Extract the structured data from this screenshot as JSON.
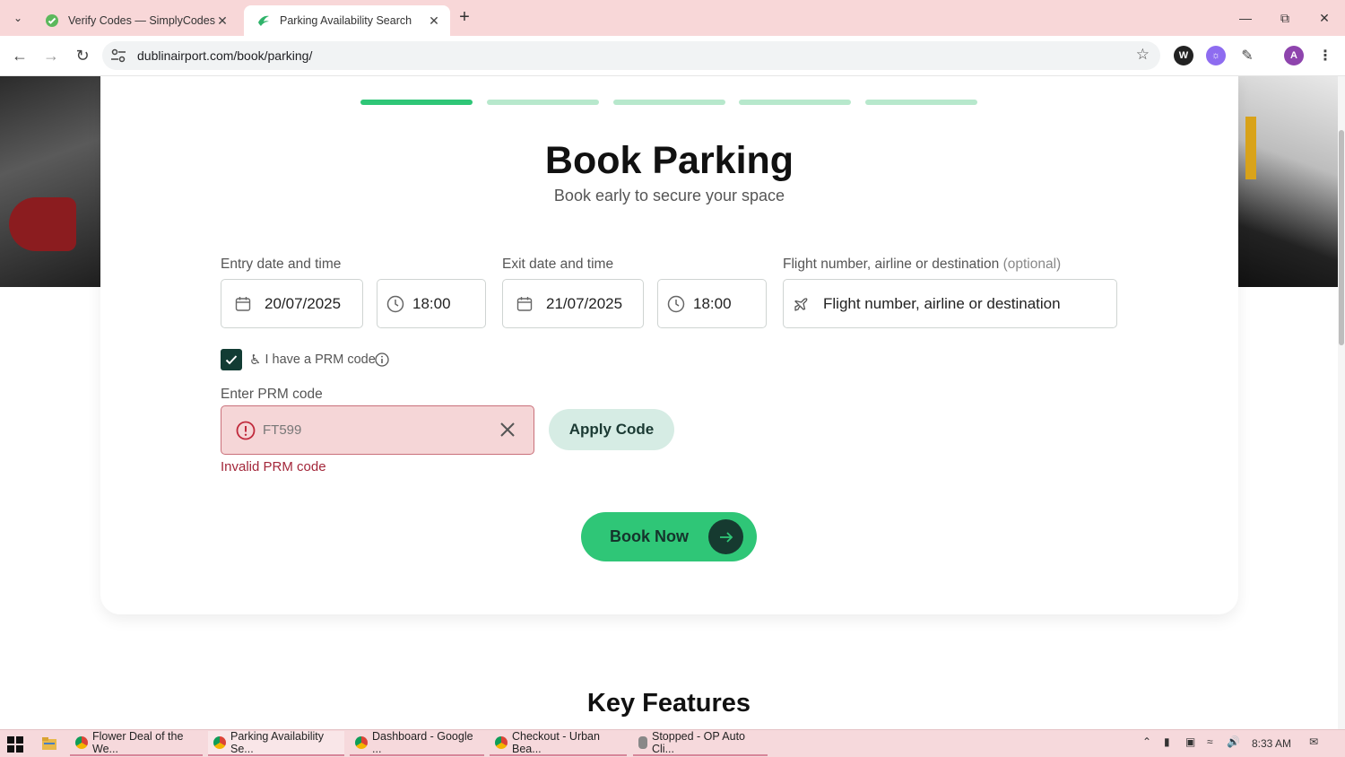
{
  "browser": {
    "tabs": [
      {
        "title": "Verify Codes — SimplyCodes",
        "active": false
      },
      {
        "title": "Parking Availability Search",
        "active": true
      }
    ],
    "url": "dublinairport.com/book/parking/",
    "profile_initial": "A"
  },
  "progress": {
    "total_steps": 5,
    "current_step": 1,
    "colors": {
      "active": "#2fc677",
      "inactive": "#b7e8cc"
    }
  },
  "page": {
    "title": "Book Parking",
    "subtitle": "Book early to secure your space",
    "entry": {
      "label": "Entry date and time",
      "date": "20/07/2025",
      "time": "18:00"
    },
    "exit": {
      "label": "Exit date and time",
      "date": "21/07/2025",
      "time": "18:00"
    },
    "flight": {
      "label": "Flight number, airline or destination",
      "optional": "(optional)",
      "placeholder": "Flight number, airline or destination"
    },
    "prm_checkbox": {
      "label": "I have a PRM code",
      "checked": true
    },
    "prm": {
      "label": "Enter PRM code",
      "value": "FT599",
      "error": "Invalid PRM code",
      "apply_label": "Apply Code"
    },
    "book_label": "Book Now",
    "next_section": "Key Features"
  },
  "taskbar": {
    "apps": [
      {
        "label": "Flower Deal of the We..."
      },
      {
        "label": "Parking Availability Se..."
      },
      {
        "label": "Dashboard - Google ..."
      },
      {
        "label": "Checkout - Urban Bea..."
      },
      {
        "label": "Stopped - OP Auto Cli..."
      }
    ],
    "time": "8:33 AM"
  },
  "colors": {
    "brand_green": "#2fc677",
    "dark_green": "#163a30",
    "error_red": "#a3273a",
    "error_bg": "#f5d6d7",
    "chrome_tab": "#f8d7d8"
  }
}
